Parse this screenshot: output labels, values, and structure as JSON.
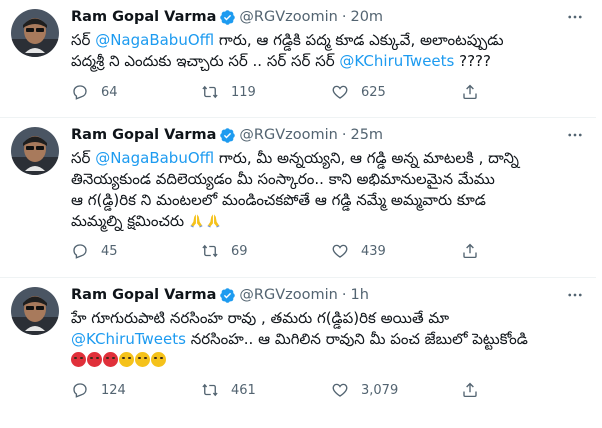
{
  "colors": {
    "link": "#1d9bf0",
    "secondary_text": "#536471",
    "primary_text": "#0f1419",
    "divider": "#eff3f4",
    "verified": "#1d9bf0"
  },
  "tweets": [
    {
      "name": "Ram Gopal Varma",
      "handle": "@RGVzoomin",
      "separator": "·",
      "time": "20m",
      "lines": [
        [
          {
            "t": "సర్ ",
            "k": "text"
          },
          {
            "t": "@NagaBabuOffl",
            "k": "mention"
          },
          {
            "t": " గారు, ఆ గడ్డికి పద్మ కూడ ఎక్కువే, అలాంటప్పుడు",
            "k": "text"
          }
        ],
        [
          {
            "t": "పద్మశ్రీ ని ఎందుకు ఇచ్చారు సర్ .. సర్ సర్ సర్ ",
            "k": "text"
          },
          {
            "t": "@KChiruTweets",
            "k": "mention"
          },
          {
            "t": " ????",
            "k": "text"
          }
        ]
      ],
      "replies": "64",
      "retweets": "119",
      "likes": "625"
    },
    {
      "name": "Ram Gopal Varma",
      "handle": "@RGVzoomin",
      "separator": "·",
      "time": "25m",
      "lines": [
        [
          {
            "t": "సర్ ",
            "k": "text"
          },
          {
            "t": "@NagaBabuOffl",
            "k": "mention"
          },
          {
            "t": " గారు, మీ అన్నయ్యని, ఆ గడ్డి అన్న మాటలకి , దాన్ని",
            "k": "text"
          }
        ],
        [
          {
            "t": "తినెయ్యకుండ వదిలెయ్యడం మీ సంస్కారం.. కాని అభిమానులమైన మేము",
            "k": "text"
          }
        ],
        [
          {
            "t": "ఆ గ(డ్డి)రిక ని మంటలలో మండించకపోతే ఆ గడ్డి నమ్మే అమ్మవారు కూడ",
            "k": "text"
          }
        ],
        [
          {
            "t": "మమ్మల్ని క్షమించరు ",
            "k": "text"
          },
          {
            "t": "folded-hands-emoji",
            "k": "pray"
          },
          {
            "t": "folded-hands-emoji",
            "k": "pray"
          }
        ]
      ],
      "replies": "45",
      "retweets": "69",
      "likes": "439"
    },
    {
      "name": "Ram Gopal Varma",
      "handle": "@RGVzoomin",
      "separator": "·",
      "time": "1h",
      "lines": [
        [
          {
            "t": "హే గూగురుపాటి నరసింహ రావు , తమరు గ(డ్డిప)రిక అయితే మా",
            "k": "text"
          }
        ],
        [
          {
            "t": "@KChiruTweets",
            "k": "mention"
          },
          {
            "t": " నరసింహ.. ఆ మిగిలిన రావుని మీ పంచ జేబులో పెట్టుకోండి",
            "k": "text"
          }
        ],
        [
          {
            "t": "angry-face-emoji",
            "k": "angry"
          },
          {
            "t": "angry-face-emoji",
            "k": "angry"
          },
          {
            "t": "angry-face-emoji",
            "k": "angry"
          },
          {
            "t": "relieved-face-emoji",
            "k": "relieved"
          },
          {
            "t": "relieved-face-emoji",
            "k": "relieved"
          },
          {
            "t": "relieved-face-emoji",
            "k": "relieved"
          }
        ]
      ],
      "replies": "124",
      "retweets": "461",
      "likes": "3,079"
    }
  ]
}
